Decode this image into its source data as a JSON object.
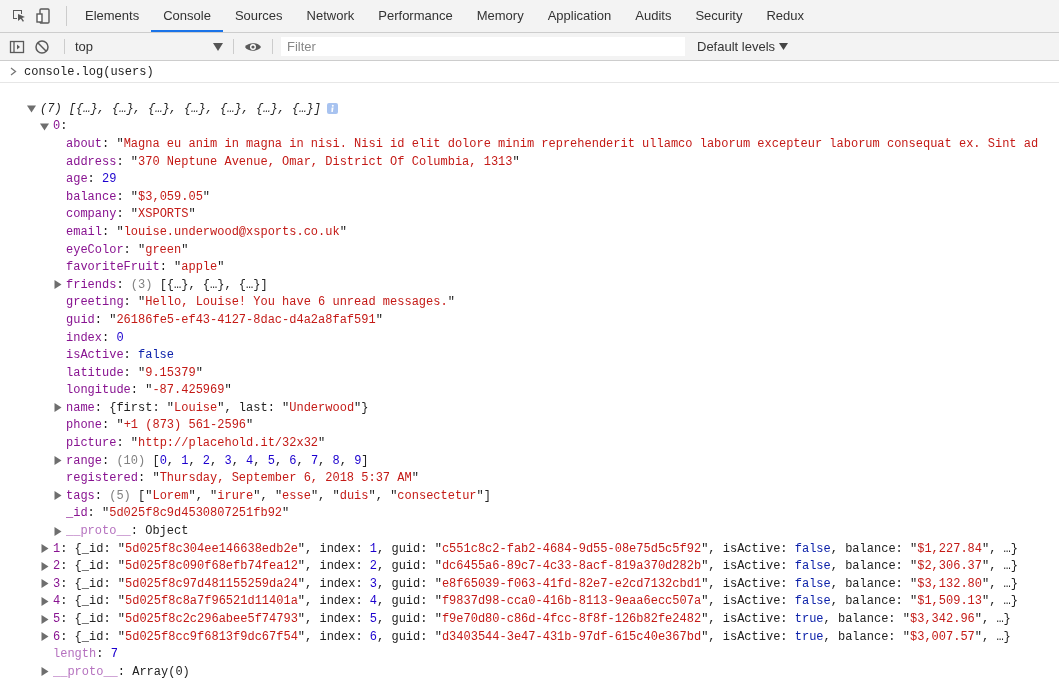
{
  "tabs": [
    {
      "label": "Elements",
      "selected": false
    },
    {
      "label": "Console",
      "selected": true
    },
    {
      "label": "Sources",
      "selected": false
    },
    {
      "label": "Network",
      "selected": false
    },
    {
      "label": "Performance",
      "selected": false
    },
    {
      "label": "Memory",
      "selected": false
    },
    {
      "label": "Application",
      "selected": false
    },
    {
      "label": "Audits",
      "selected": false
    },
    {
      "label": "Security",
      "selected": false
    },
    {
      "label": "Redux",
      "selected": false
    }
  ],
  "console_toolbar": {
    "context": "top",
    "filter": {
      "placeholder": "Filter"
    },
    "levels": "Default levels"
  },
  "input": "console.log(users)",
  "output": {
    "tokens": [
      {
        "kind": "i",
        "text": "(7) [{…}, {…}, {…}, {…}, {…}, {…}, {…}]"
      }
    ],
    "expanded": true,
    "children": [
      {
        "tokens": [
          {
            "kind": "k",
            "text": "0"
          },
          {
            "kind": "p",
            "text": ":"
          }
        ],
        "expanded": true,
        "children": [
          {
            "tokens": [
              {
                "kind": "k",
                "text": "about"
              },
              {
                "kind": "p",
                "text": ": \""
              },
              {
                "kind": "s",
                "text": "Magna eu anim in magna in nisi. Nisi id elit dolore minim reprehenderit ullamco laborum excepteur laborum consequat ex. Sint ad"
              }
            ]
          },
          {
            "tokens": [
              {
                "kind": "k",
                "text": "address"
              },
              {
                "kind": "p",
                "text": ": \""
              },
              {
                "kind": "s",
                "text": "370 Neptune Avenue, Omar, District Of Columbia, 1313"
              },
              {
                "kind": "p",
                "text": "\""
              }
            ]
          },
          {
            "tokens": [
              {
                "kind": "k",
                "text": "age"
              },
              {
                "kind": "p",
                "text": ": "
              },
              {
                "kind": "n",
                "text": "29"
              }
            ]
          },
          {
            "tokens": [
              {
                "kind": "k",
                "text": "balance"
              },
              {
                "kind": "p",
                "text": ": \""
              },
              {
                "kind": "s",
                "text": "$3,059.05"
              },
              {
                "kind": "p",
                "text": "\""
              }
            ]
          },
          {
            "tokens": [
              {
                "kind": "k",
                "text": "company"
              },
              {
                "kind": "p",
                "text": ": \""
              },
              {
                "kind": "s",
                "text": "XSPORTS"
              },
              {
                "kind": "p",
                "text": "\""
              }
            ]
          },
          {
            "tokens": [
              {
                "kind": "k",
                "text": "email"
              },
              {
                "kind": "p",
                "text": ": \""
              },
              {
                "kind": "s",
                "text": "louise.underwood@xsports.co.uk"
              },
              {
                "kind": "p",
                "text": "\""
              }
            ]
          },
          {
            "tokens": [
              {
                "kind": "k",
                "text": "eyeColor"
              },
              {
                "kind": "p",
                "text": ": \""
              },
              {
                "kind": "s",
                "text": "green"
              },
              {
                "kind": "p",
                "text": "\""
              }
            ]
          },
          {
            "tokens": [
              {
                "kind": "k",
                "text": "favoriteFruit"
              },
              {
                "kind": "p",
                "text": ": \""
              },
              {
                "kind": "s",
                "text": "apple"
              },
              {
                "kind": "p",
                "text": "\""
              }
            ]
          },
          {
            "tokens": [
              {
                "kind": "k",
                "text": "friends"
              },
              {
                "kind": "p",
                "text": ": "
              },
              {
                "kind": "m",
                "text": "(3)"
              },
              {
                "kind": "p",
                "text": " [{…}, {…}, {…}]"
              }
            ],
            "expanded": false
          },
          {
            "tokens": [
              {
                "kind": "k",
                "text": "greeting"
              },
              {
                "kind": "p",
                "text": ": \""
              },
              {
                "kind": "s",
                "text": "Hello, Louise! You have 6 unread messages."
              },
              {
                "kind": "p",
                "text": "\""
              }
            ]
          },
          {
            "tokens": [
              {
                "kind": "k",
                "text": "guid"
              },
              {
                "kind": "p",
                "text": ": \""
              },
              {
                "kind": "s",
                "text": "26186fe5-ef43-4127-8dac-d4a2a8faf591"
              },
              {
                "kind": "p",
                "text": "\""
              }
            ]
          },
          {
            "tokens": [
              {
                "kind": "k",
                "text": "index"
              },
              {
                "kind": "p",
                "text": ": "
              },
              {
                "kind": "n",
                "text": "0"
              }
            ]
          },
          {
            "tokens": [
              {
                "kind": "k",
                "text": "isActive"
              },
              {
                "kind": "p",
                "text": ": "
              },
              {
                "kind": "b",
                "text": "false"
              }
            ]
          },
          {
            "tokens": [
              {
                "kind": "k",
                "text": "latitude"
              },
              {
                "kind": "p",
                "text": ": \""
              },
              {
                "kind": "s",
                "text": "9.15379"
              },
              {
                "kind": "p",
                "text": "\""
              }
            ]
          },
          {
            "tokens": [
              {
                "kind": "k",
                "text": "longitude"
              },
              {
                "kind": "p",
                "text": ": \""
              },
              {
                "kind": "s",
                "text": "-87.425969"
              },
              {
                "kind": "p",
                "text": "\""
              }
            ]
          },
          {
            "tokens": [
              {
                "kind": "k",
                "text": "name"
              },
              {
                "kind": "p",
                "text": ": {first: \""
              },
              {
                "kind": "s",
                "text": "Louise"
              },
              {
                "kind": "p",
                "text": "\", last: \""
              },
              {
                "kind": "s",
                "text": "Underwood"
              },
              {
                "kind": "p",
                "text": "\"}"
              }
            ],
            "expanded": false
          },
          {
            "tokens": [
              {
                "kind": "k",
                "text": "phone"
              },
              {
                "kind": "p",
                "text": ": \""
              },
              {
                "kind": "s",
                "text": "+1 (873) 561-2596"
              },
              {
                "kind": "p",
                "text": "\""
              }
            ]
          },
          {
            "tokens": [
              {
                "kind": "k",
                "text": "picture"
              },
              {
                "kind": "p",
                "text": ": \""
              },
              {
                "kind": "s",
                "text": "http://placehold.it/32x32"
              },
              {
                "kind": "p",
                "text": "\""
              }
            ]
          },
          {
            "tokens": [
              {
                "kind": "k",
                "text": "range"
              },
              {
                "kind": "p",
                "text": ": "
              },
              {
                "kind": "m",
                "text": "(10)"
              },
              {
                "kind": "p",
                "text": " ["
              },
              {
                "kind": "n",
                "text": "0"
              },
              {
                "kind": "p",
                "text": ", "
              },
              {
                "kind": "n",
                "text": "1"
              },
              {
                "kind": "p",
                "text": ", "
              },
              {
                "kind": "n",
                "text": "2"
              },
              {
                "kind": "p",
                "text": ", "
              },
              {
                "kind": "n",
                "text": "3"
              },
              {
                "kind": "p",
                "text": ", "
              },
              {
                "kind": "n",
                "text": "4"
              },
              {
                "kind": "p",
                "text": ", "
              },
              {
                "kind": "n",
                "text": "5"
              },
              {
                "kind": "p",
                "text": ", "
              },
              {
                "kind": "n",
                "text": "6"
              },
              {
                "kind": "p",
                "text": ", "
              },
              {
                "kind": "n",
                "text": "7"
              },
              {
                "kind": "p",
                "text": ", "
              },
              {
                "kind": "n",
                "text": "8"
              },
              {
                "kind": "p",
                "text": ", "
              },
              {
                "kind": "n",
                "text": "9"
              },
              {
                "kind": "p",
                "text": "]"
              }
            ],
            "expanded": false
          },
          {
            "tokens": [
              {
                "kind": "k",
                "text": "registered"
              },
              {
                "kind": "p",
                "text": ": \""
              },
              {
                "kind": "s",
                "text": "Thursday, September 6, 2018 5:37 AM"
              },
              {
                "kind": "p",
                "text": "\""
              }
            ]
          },
          {
            "tokens": [
              {
                "kind": "k",
                "text": "tags"
              },
              {
                "kind": "p",
                "text": ": "
              },
              {
                "kind": "m",
                "text": "(5)"
              },
              {
                "kind": "p",
                "text": " [\""
              },
              {
                "kind": "s",
                "text": "Lorem"
              },
              {
                "kind": "p",
                "text": "\", \""
              },
              {
                "kind": "s",
                "text": "irure"
              },
              {
                "kind": "p",
                "text": "\", \""
              },
              {
                "kind": "s",
                "text": "esse"
              },
              {
                "kind": "p",
                "text": "\", \""
              },
              {
                "kind": "s",
                "text": "duis"
              },
              {
                "kind": "p",
                "text": "\", \""
              },
              {
                "kind": "s",
                "text": "consectetur"
              },
              {
                "kind": "p",
                "text": "\"]"
              }
            ],
            "expanded": false
          },
          {
            "tokens": [
              {
                "kind": "k",
                "text": "_id"
              },
              {
                "kind": "p",
                "text": ": \""
              },
              {
                "kind": "s",
                "text": "5d025f8c9d4530807251fb92"
              },
              {
                "kind": "p",
                "text": "\""
              }
            ]
          },
          {
            "tokens": [
              {
                "kind": "d",
                "text": "__proto__"
              },
              {
                "kind": "p",
                "text": ": Object"
              }
            ],
            "expanded": false
          }
        ]
      },
      {
        "tokens": [
          {
            "kind": "k",
            "text": "1"
          },
          {
            "kind": "p",
            "text": ": {_id: \""
          },
          {
            "kind": "s",
            "text": "5d025f8c304ee146638edb2e"
          },
          {
            "kind": "p",
            "text": "\", index: "
          },
          {
            "kind": "n",
            "text": "1"
          },
          {
            "kind": "p",
            "text": ", guid: \""
          },
          {
            "kind": "s",
            "text": "c551c8c2-fab2-4684-9d55-08e75d5c5f92"
          },
          {
            "kind": "p",
            "text": "\", isActive: "
          },
          {
            "kind": "b",
            "text": "false"
          },
          {
            "kind": "p",
            "text": ", balance: \""
          },
          {
            "kind": "s",
            "text": "$1,227.84"
          },
          {
            "kind": "p",
            "text": "\", …}"
          }
        ],
        "expanded": false
      },
      {
        "tokens": [
          {
            "kind": "k",
            "text": "2"
          },
          {
            "kind": "p",
            "text": ": {_id: \""
          },
          {
            "kind": "s",
            "text": "5d025f8c090f68efb74fea12"
          },
          {
            "kind": "p",
            "text": "\", index: "
          },
          {
            "kind": "n",
            "text": "2"
          },
          {
            "kind": "p",
            "text": ", guid: \""
          },
          {
            "kind": "s",
            "text": "dc6455a6-89c7-4c33-8acf-819a370d282b"
          },
          {
            "kind": "p",
            "text": "\", isActive: "
          },
          {
            "kind": "b",
            "text": "false"
          },
          {
            "kind": "p",
            "text": ", balance: \""
          },
          {
            "kind": "s",
            "text": "$2,306.37"
          },
          {
            "kind": "p",
            "text": "\", …}"
          }
        ],
        "expanded": false
      },
      {
        "tokens": [
          {
            "kind": "k",
            "text": "3"
          },
          {
            "kind": "p",
            "text": ": {_id: \""
          },
          {
            "kind": "s",
            "text": "5d025f8c97d481155259da24"
          },
          {
            "kind": "p",
            "text": "\", index: "
          },
          {
            "kind": "n",
            "text": "3"
          },
          {
            "kind": "p",
            "text": ", guid: \""
          },
          {
            "kind": "s",
            "text": "e8f65039-f063-41fd-82e7-e2cd7132cbd1"
          },
          {
            "kind": "p",
            "text": "\", isActive: "
          },
          {
            "kind": "b",
            "text": "false"
          },
          {
            "kind": "p",
            "text": ", balance: \""
          },
          {
            "kind": "s",
            "text": "$3,132.80"
          },
          {
            "kind": "p",
            "text": "\", …}"
          }
        ],
        "expanded": false
      },
      {
        "tokens": [
          {
            "kind": "k",
            "text": "4"
          },
          {
            "kind": "p",
            "text": ": {_id: \""
          },
          {
            "kind": "s",
            "text": "5d025f8c8a7f96521d11401a"
          },
          {
            "kind": "p",
            "text": "\", index: "
          },
          {
            "kind": "n",
            "text": "4"
          },
          {
            "kind": "p",
            "text": ", guid: \""
          },
          {
            "kind": "s",
            "text": "f9837d98-cca0-416b-8113-9eaa6ecc507a"
          },
          {
            "kind": "p",
            "text": "\", isActive: "
          },
          {
            "kind": "b",
            "text": "false"
          },
          {
            "kind": "p",
            "text": ", balance: \""
          },
          {
            "kind": "s",
            "text": "$1,509.13"
          },
          {
            "kind": "p",
            "text": "\", …}"
          }
        ],
        "expanded": false
      },
      {
        "tokens": [
          {
            "kind": "k",
            "text": "5"
          },
          {
            "kind": "p",
            "text": ": {_id: \""
          },
          {
            "kind": "s",
            "text": "5d025f8c2c296abee5f74793"
          },
          {
            "kind": "p",
            "text": "\", index: "
          },
          {
            "kind": "n",
            "text": "5"
          },
          {
            "kind": "p",
            "text": ", guid: \""
          },
          {
            "kind": "s",
            "text": "f9e70d80-c86d-4fcc-8f8f-126b82fe2482"
          },
          {
            "kind": "p",
            "text": "\", isActive: "
          },
          {
            "kind": "b",
            "text": "true"
          },
          {
            "kind": "p",
            "text": ", balance: \""
          },
          {
            "kind": "s",
            "text": "$3,342.96"
          },
          {
            "kind": "p",
            "text": "\", …}"
          }
        ],
        "expanded": false
      },
      {
        "tokens": [
          {
            "kind": "k",
            "text": "6"
          },
          {
            "kind": "p",
            "text": ": {_id: \""
          },
          {
            "kind": "s",
            "text": "5d025f8cc9f6813f9dc67f54"
          },
          {
            "kind": "p",
            "text": "\", index: "
          },
          {
            "kind": "n",
            "text": "6"
          },
          {
            "kind": "p",
            "text": ", guid: \""
          },
          {
            "kind": "s",
            "text": "d3403544-3e47-431b-97df-615c40e367bd"
          },
          {
            "kind": "p",
            "text": "\", isActive: "
          },
          {
            "kind": "b",
            "text": "true"
          },
          {
            "kind": "p",
            "text": ", balance: \""
          },
          {
            "kind": "s",
            "text": "$3,007.57"
          },
          {
            "kind": "p",
            "text": "\", …}"
          }
        ],
        "expanded": false
      },
      {
        "tokens": [
          {
            "kind": "d",
            "text": "length"
          },
          {
            "kind": "p",
            "text": ": "
          },
          {
            "kind": "n",
            "text": "7"
          }
        ]
      },
      {
        "tokens": [
          {
            "kind": "d",
            "text": "__proto__"
          },
          {
            "kind": "p",
            "text": ": Array(0)"
          }
        ],
        "expanded": false
      }
    ]
  }
}
